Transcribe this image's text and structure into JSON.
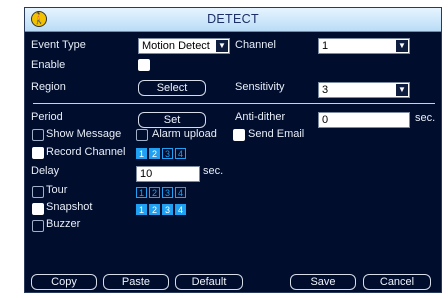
{
  "window": {
    "title": "DETECT",
    "logo_icon": "person-walking-icon"
  },
  "labels": {
    "event_type": "Event Type",
    "channel": "Channel",
    "enable": "Enable",
    "region": "Region",
    "sensitivity": "Sensitivity",
    "period": "Period",
    "anti_dither": "Anti-dither",
    "anti_dither_unit": "sec.",
    "show_message": "Show Message",
    "alarm_upload": "Alarm upload",
    "send_email": "Send Email",
    "record_channel": "Record Channel",
    "delay": "Delay",
    "delay_unit": "sec.",
    "tour": "Tour",
    "snapshot": "Snapshot",
    "buzzer": "Buzzer"
  },
  "fields": {
    "event_type": "Motion Detect",
    "channel": "1",
    "sensitivity": "3",
    "anti_dither": "0",
    "delay": "10"
  },
  "buttons": {
    "region": "Select",
    "period": "Set",
    "copy": "Copy",
    "paste": "Paste",
    "default": "Default",
    "save": "Save",
    "cancel": "Cancel"
  },
  "channel_numbers": [
    "1",
    "2",
    "3",
    "4"
  ],
  "colors": {
    "panel_bg": "#000d2d",
    "titlebar_bg": "#cfe7fa",
    "channel_selected": "#1fa0f2"
  }
}
